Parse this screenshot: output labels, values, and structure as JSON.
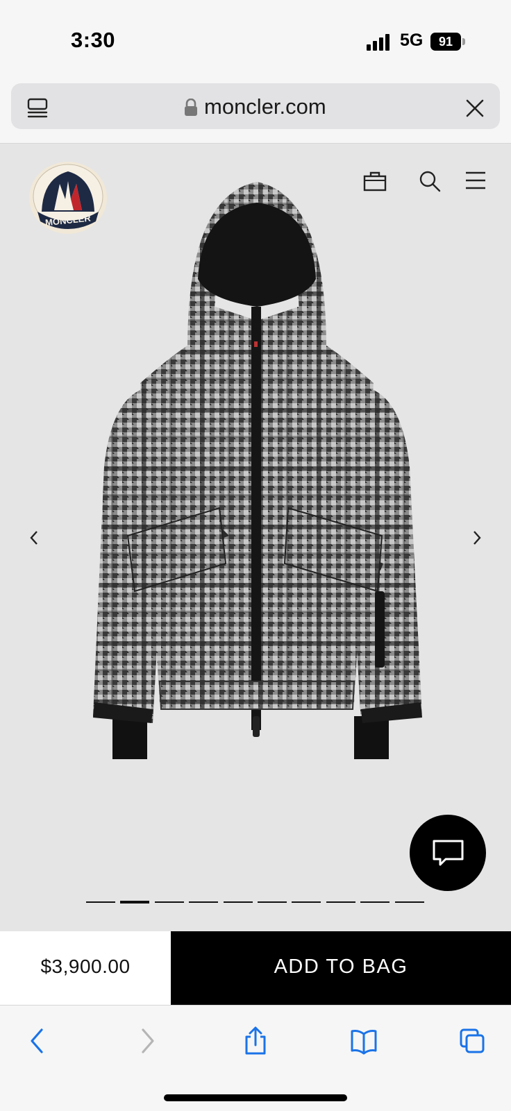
{
  "status_bar": {
    "time": "3:30",
    "network": "5G",
    "battery": "91",
    "signal_bars": 4
  },
  "browser": {
    "url": "moncler.com",
    "icons": {
      "tabs": "tab-overview-icon",
      "lock": "lock-icon",
      "close": "close-icon"
    }
  },
  "header": {
    "logo_text": "MONCLER",
    "icons": [
      "shopping-bag-icon",
      "search-icon",
      "hamburger-menu-icon"
    ]
  },
  "gallery": {
    "image": "grey-houndstooth-hooded-jacket",
    "total_slides": 10,
    "active_slide": 2,
    "prev_icon": "chevron-left-icon",
    "next_icon": "chevron-right-icon"
  },
  "chat": {
    "icon": "chat-bubble-icon"
  },
  "purchase": {
    "price": "$3,900.00",
    "add_to_bag": "ADD TO BAG"
  },
  "toolbar": {
    "icons": [
      "back-icon",
      "forward-icon",
      "share-icon",
      "bookmarks-icon",
      "tabs-icon"
    ]
  },
  "colors": {
    "ios_blue": "#1a73e8",
    "black": "#000000",
    "background": "#e5e5e5"
  }
}
